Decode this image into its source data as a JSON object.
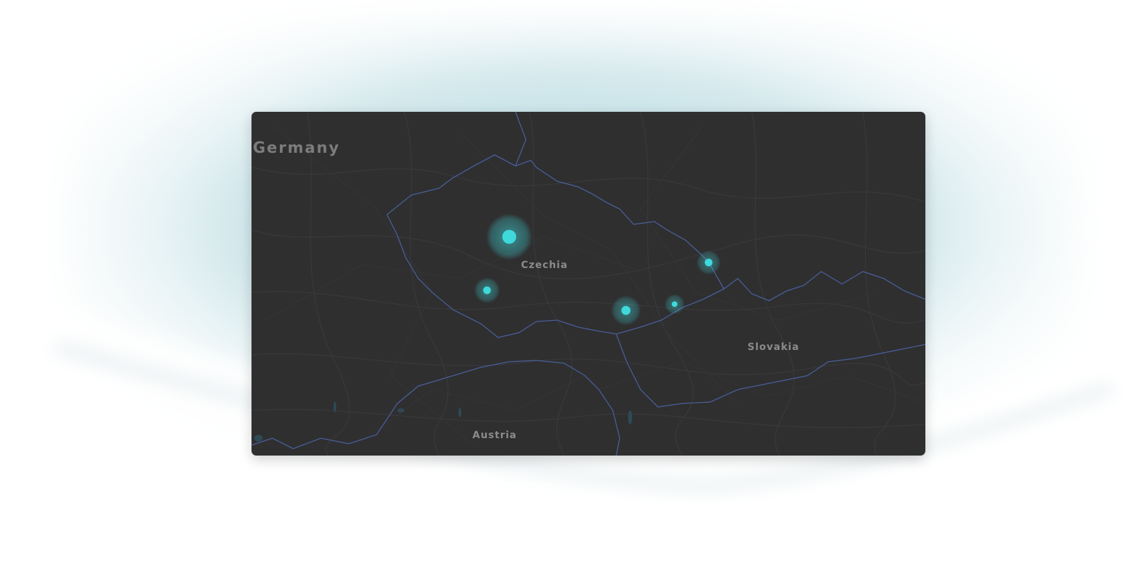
{
  "map": {
    "labels": {
      "germany": "Germany",
      "czechia": "Czechia",
      "slovakia": "Slovakia",
      "austria": "Austria"
    },
    "markers": [
      {
        "name": "marker-large",
        "intensity": 1.0
      },
      {
        "name": "marker-west",
        "intensity": 0.45
      },
      {
        "name": "marker-south-central",
        "intensity": 0.55
      },
      {
        "name": "marker-east-small",
        "intensity": 0.3
      },
      {
        "name": "marker-northeast",
        "intensity": 0.4
      }
    ],
    "colors": {
      "land": "#2f2f30",
      "border": "#4a5f9a",
      "roads": "#3c3c3e",
      "marker": "#3fd9dc",
      "label": "#8b8b8b"
    }
  }
}
